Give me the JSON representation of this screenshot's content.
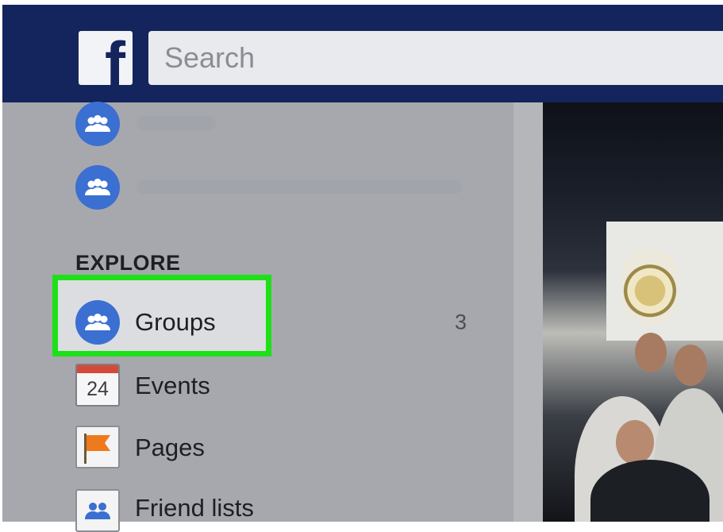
{
  "header": {
    "logo_letter": "f",
    "search_placeholder": "Search"
  },
  "sidebar": {
    "explore_title": "EXPLORE",
    "items": [
      {
        "label": "Groups",
        "count": "3",
        "icon": "groups-icon",
        "highlighted": true
      },
      {
        "label": "Events",
        "icon": "calendar-icon",
        "calendar_day": "24"
      },
      {
        "label": "Pages",
        "icon": "flag-icon"
      },
      {
        "label": "Friend lists",
        "icon": "friend-list-icon"
      }
    ]
  },
  "colors": {
    "nav_blue": "#14245c",
    "group_icon_blue": "#3b6fd1",
    "highlight_green": "#1ee01a",
    "overlay_gray": "#a7a8ad"
  }
}
